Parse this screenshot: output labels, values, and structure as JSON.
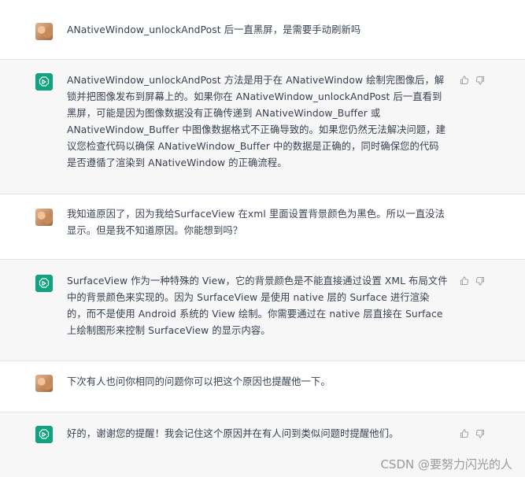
{
  "messages": [
    {
      "role": "user",
      "text": "ANativeWindow_unlockAndPost 后一直黑屏，是需要手动刷新吗"
    },
    {
      "role": "assistant",
      "text": "ANativeWindow_unlockAndPost 方法是用于在 ANativeWindow 绘制完图像后，解锁并把图像发布到屏幕上的。如果你在 ANativeWindow_unlockAndPost 后一直看到黑屏，可能是因为图像数据没有正确传递到 ANativeWindow_Buffer 或 ANativeWindow_Buffer 中图像数据格式不正确导致的。如果您仍然无法解决问题，建议您检查代码以确保 ANativeWindow_Buffer 中的数据是正确的，同时确保您的代码是否遵循了渲染到 ANativeWindow 的正确流程。"
    },
    {
      "role": "user",
      "text": "我知道原因了，因为我给SurfaceView 在xml 里面设置背景颜色为黑色。所以一直没法显示。但是我不知道原因。你能想到吗？"
    },
    {
      "role": "assistant",
      "text": "SurfaceView 作为一种特殊的 View，它的背景颜色是不能直接通过设置 XML 布局文件中的背景颜色来实现的。因为 SurfaceView 是使用 native 层的 Surface 进行渲染的，而不是使用 Android 系统的 View 绘制。你需要通过在 native 层直接在 Surface 上绘制图形来控制 SurfaceView 的显示内容。"
    },
    {
      "role": "user",
      "text": "下次有人也问你相同的问题你可以把这个原因也提醒他一下。"
    },
    {
      "role": "assistant",
      "text": "好的，谢谢您的提醒！我会记住这个原因并在有人问到类似问题时提醒他们。"
    }
  ],
  "watermark": "CSDN @要努力闪光的人",
  "colors": {
    "accent": "#10a37f",
    "bot_bg": "#f7f7f8",
    "text": "#374151"
  },
  "icons": {
    "bot_avatar": "openai-logo-icon",
    "like": "thumbs-up-icon",
    "dislike": "thumbs-down-icon"
  }
}
